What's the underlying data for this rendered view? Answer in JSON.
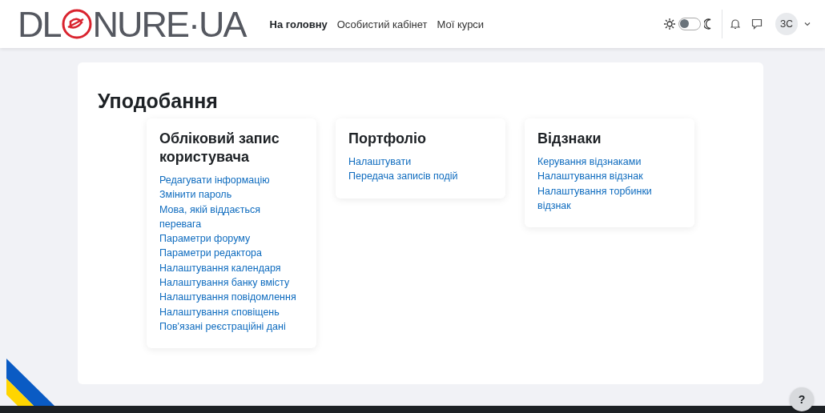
{
  "navbar": {
    "logo": {
      "left": "DL",
      "right": "NURE·UA"
    },
    "links": [
      {
        "label": "На головну",
        "selected": true
      },
      {
        "label": "Особистий кабінет",
        "selected": false
      },
      {
        "label": "Мої курси",
        "selected": false
      }
    ],
    "dark_mode": {
      "on": false
    },
    "user": {
      "initials": "ЗС"
    }
  },
  "page": {
    "title": "Уподобання",
    "sections": [
      {
        "title": "Обліковий запис користувача",
        "links": [
          "Редагувати інформацію",
          "Змінити пароль",
          "Мова, якій віддається перевага",
          "Параметри форуму",
          "Параметри редактора",
          "Налаштування календаря",
          "Налаштування банку вмісту",
          "Налаштування повідомлення",
          "Налаштування сповіщень",
          "Пов'язані реєстраційні дані"
        ]
      },
      {
        "title": "Портфоліо",
        "links": [
          "Налаштувати",
          "Передача записів подій"
        ]
      },
      {
        "title": "Відзнаки",
        "links": [
          "Керування відзнаками",
          "Налаштування відзнак",
          "Налаштування торбинки відзнак"
        ]
      }
    ]
  },
  "help": {
    "label": "?"
  }
}
